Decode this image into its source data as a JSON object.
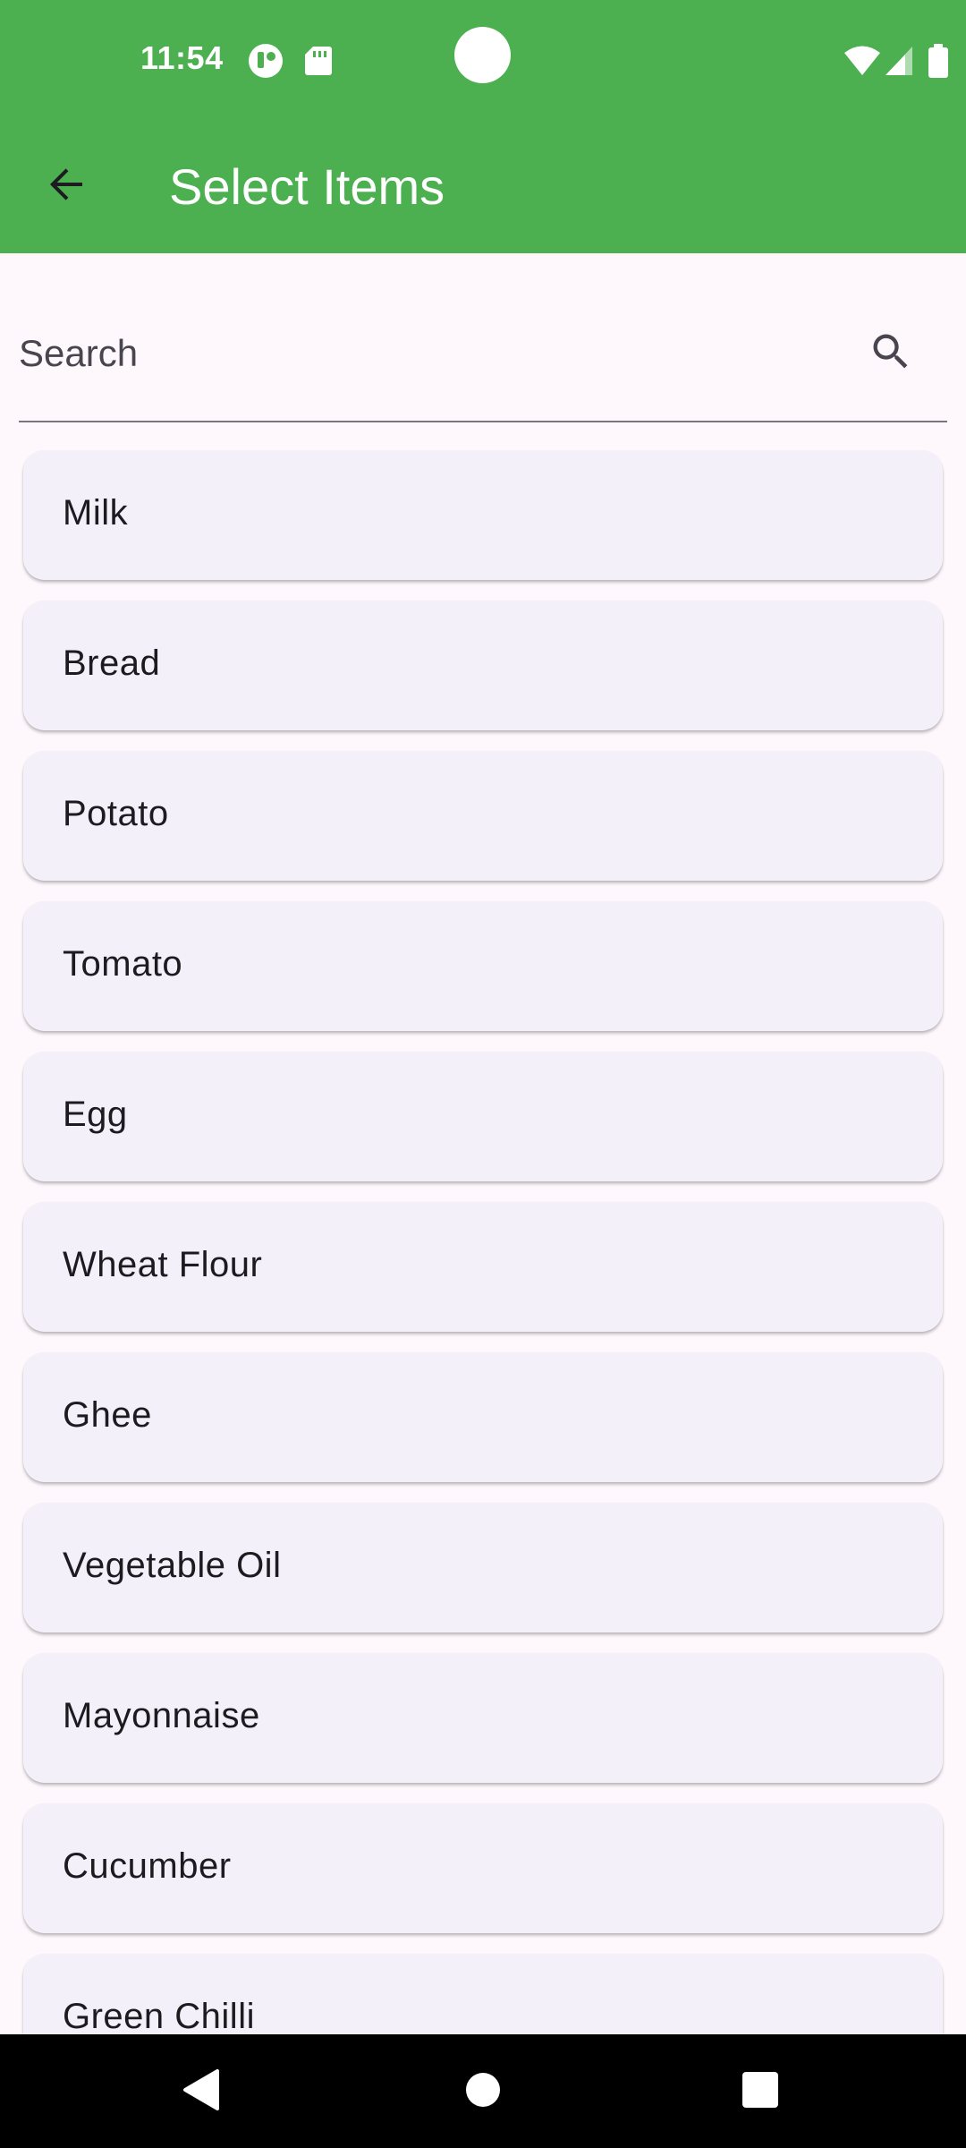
{
  "status_bar": {
    "time": "11:54",
    "left_icons": [
      "app-notification-icon",
      "sd-card-icon"
    ],
    "right_icons": [
      "wifi-icon",
      "cellular-signal-icon",
      "battery-icon"
    ]
  },
  "app_bar": {
    "title": "Select Items",
    "background_color": "#4caf50",
    "back_icon": "arrow-back-icon"
  },
  "search": {
    "placeholder": "Search",
    "value": "",
    "icon": "search-icon"
  },
  "items": [
    {
      "label": "Milk"
    },
    {
      "label": "Bread"
    },
    {
      "label": "Potato"
    },
    {
      "label": "Tomato"
    },
    {
      "label": "Egg"
    },
    {
      "label": "Wheat Flour"
    },
    {
      "label": "Ghee"
    },
    {
      "label": "Vegetable Oil"
    },
    {
      "label": "Mayonnaise"
    },
    {
      "label": "Cucumber"
    },
    {
      "label": "Green Chilli"
    }
  ],
  "nav_bar": {
    "buttons": [
      "back-triangle-icon",
      "home-circle-icon",
      "recents-square-icon"
    ]
  }
}
